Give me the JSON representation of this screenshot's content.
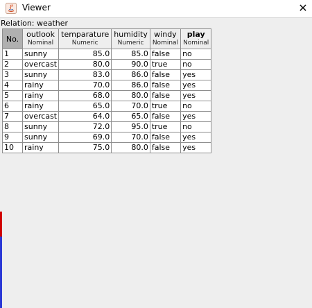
{
  "window": {
    "title": "Viewer",
    "close_glyph": "✕"
  },
  "relation": {
    "label": "Relation: weather"
  },
  "table": {
    "index_header": "No.",
    "columns": [
      {
        "name": "outlook",
        "type": "Nominal",
        "bold": false
      },
      {
        "name": "temparature",
        "type": "Numeric",
        "bold": false
      },
      {
        "name": "humidity",
        "type": "Numeric",
        "bold": false
      },
      {
        "name": "windy",
        "type": "Nominal",
        "bold": false
      },
      {
        "name": "play",
        "type": "Nominal",
        "bold": true
      }
    ],
    "rows": [
      {
        "no": "1",
        "outlook": "sunny",
        "temparature": "85.0",
        "humidity": "85.0",
        "windy": "false",
        "play": "no"
      },
      {
        "no": "2",
        "outlook": "overcast",
        "temparature": "80.0",
        "humidity": "90.0",
        "windy": "true",
        "play": "no"
      },
      {
        "no": "3",
        "outlook": "sunny",
        "temparature": "83.0",
        "humidity": "86.0",
        "windy": "false",
        "play": "yes"
      },
      {
        "no": "4",
        "outlook": "rainy",
        "temparature": "70.0",
        "humidity": "86.0",
        "windy": "false",
        "play": "yes"
      },
      {
        "no": "5",
        "outlook": "rainy",
        "temparature": "68.0",
        "humidity": "80.0",
        "windy": "false",
        "play": "yes"
      },
      {
        "no": "6",
        "outlook": "rainy",
        "temparature": "65.0",
        "humidity": "70.0",
        "windy": "true",
        "play": "no"
      },
      {
        "no": "7",
        "outlook": "overcast",
        "temparature": "64.0",
        "humidity": "65.0",
        "windy": "false",
        "play": "yes"
      },
      {
        "no": "8",
        "outlook": "sunny",
        "temparature": "72.0",
        "humidity": "95.0",
        "windy": "true",
        "play": "no"
      },
      {
        "no": "9",
        "outlook": "sunny",
        "temparature": "69.0",
        "humidity": "70.0",
        "windy": "false",
        "play": "yes"
      },
      {
        "no": "10",
        "outlook": "rainy",
        "temparature": "75.0",
        "humidity": "80.0",
        "windy": "false",
        "play": "yes"
      }
    ]
  },
  "colors": {
    "index_header_bg": "#b0b0b0",
    "grid_line": "#8e8e8e",
    "accent_red": "#d10000",
    "accent_blue": "#2b39d6"
  },
  "icons": {
    "app": "java-app-icon",
    "close": "close-icon"
  }
}
